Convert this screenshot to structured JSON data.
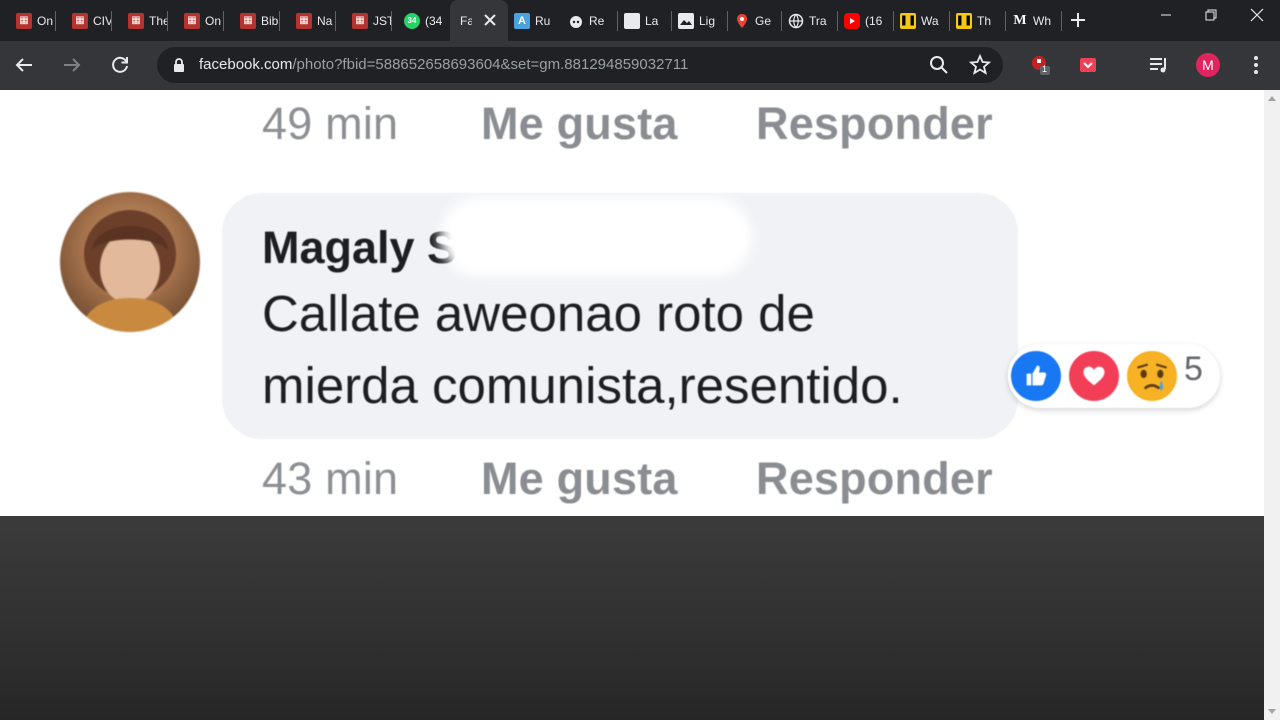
{
  "browser": {
    "tabs": [
      {
        "label": "On",
        "icon": "jstor-icon"
      },
      {
        "label": "CIV",
        "icon": "jstor-icon"
      },
      {
        "label": "The",
        "icon": "jstor-icon"
      },
      {
        "label": "On",
        "icon": "jstor-icon"
      },
      {
        "label": "Bib",
        "icon": "jstor-icon"
      },
      {
        "label": "Na",
        "icon": "jstor-icon"
      },
      {
        "label": "JST",
        "icon": "jstor-icon"
      },
      {
        "label": "(34",
        "icon": "whatsapp-icon",
        "badge": "34"
      },
      {
        "label": "Fa",
        "icon": "facebook-icon",
        "active": true
      },
      {
        "label": "Ru",
        "icon": "translate-icon"
      },
      {
        "label": "Re",
        "icon": "reddit-icon"
      },
      {
        "label": "La",
        "icon": "document-icon"
      },
      {
        "label": "Lig",
        "icon": "image-icon"
      },
      {
        "label": "Ge",
        "icon": "map-pin-icon"
      },
      {
        "label": "Tra",
        "icon": "globe-icon"
      },
      {
        "label": "(16",
        "icon": "youtube-icon"
      },
      {
        "label": "Wa",
        "icon": "wikiwand-icon"
      },
      {
        "label": "Th",
        "icon": "wikiwand-icon"
      },
      {
        "label": "Wh",
        "icon": "medium-icon"
      }
    ],
    "address": {
      "host": "facebook.com",
      "path": "/photo?fbid=588652658693604&set=gm.881294859032711"
    },
    "extension_badge": "1",
    "profile_initial": "M"
  },
  "post": {
    "prev_meta": {
      "time": "49 min",
      "like": "Me gusta",
      "reply": "Responder"
    },
    "comment": {
      "author": "Magaly S",
      "line1": "Callate aweonao roto de",
      "line2": "mierda comunista,resentido.",
      "reaction_count": "5",
      "reactions": [
        "like",
        "love",
        "sad"
      ]
    },
    "meta": {
      "time": "43 min",
      "like": "Me gusta",
      "reply": "Responder"
    }
  },
  "colors": {
    "like": "#1877f2",
    "love": "#f33e58",
    "sad": "#f7b125",
    "bubble": "#f0f2f5",
    "chrome_dark": "#202124",
    "chrome_toolbar": "#35363a"
  }
}
